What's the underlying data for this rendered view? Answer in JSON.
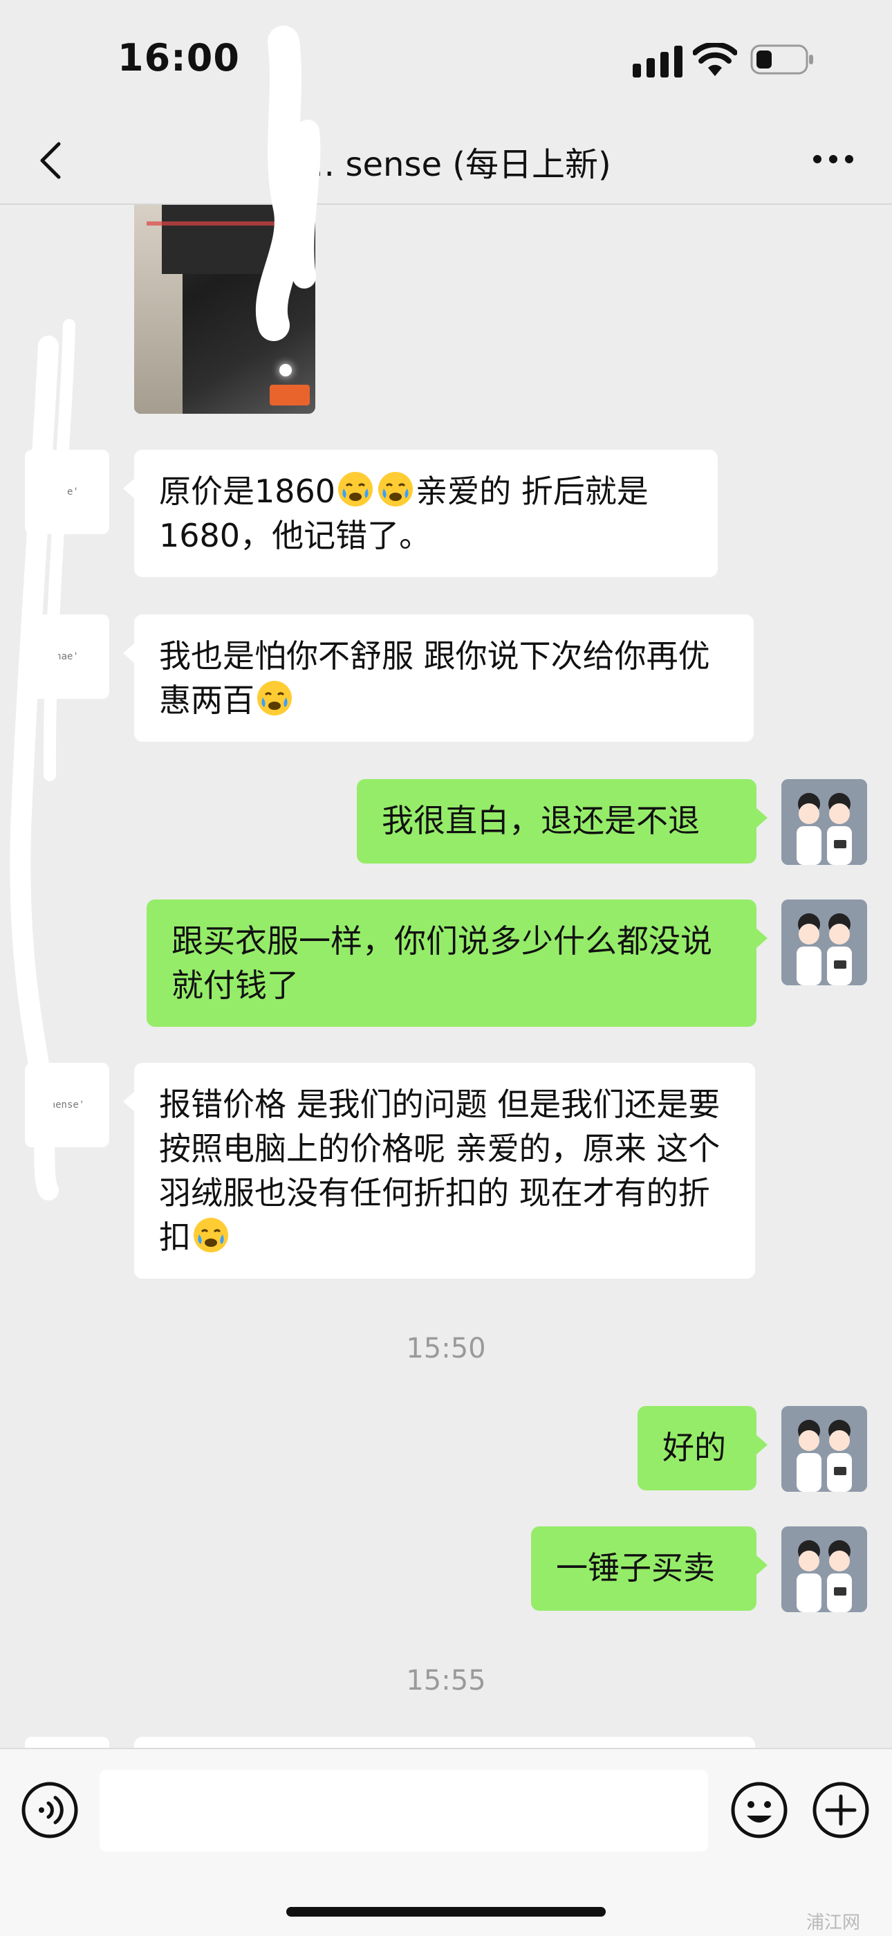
{
  "status_bar": {
    "time": "16:00"
  },
  "nav": {
    "title": "… sense (每日上新)"
  },
  "avatar_labels": {
    "seller_1": "nae'",
    "seller_2": "nae'",
    "seller_3": "aense'"
  },
  "messages": {
    "m1": {
      "part1": "原价是1860",
      "part2": "亲爱的 折后就是1680，他记错了。"
    },
    "m2": {
      "part1": "我也是怕你不舒服 跟你说下次给你再优惠两百"
    },
    "m3": {
      "text": "我很直白，退还是不退"
    },
    "m4": {
      "text": "跟买衣服一样，你们说多少什么都没说就付钱了"
    },
    "m5": {
      "part1": "报错价格 是我们的问题 但是我们还是要按照电脑上的价格呢 亲爱的，原来 这个羽绒服也没有任何折扣的 现在才有的折扣"
    },
    "m6": {
      "text": "好的"
    },
    "m7": {
      "text": "一锤子买卖"
    }
  },
  "timestamps": {
    "t1": "15:50",
    "t2": "15:55"
  },
  "input": {
    "placeholder": ""
  },
  "watermark": "浦江网",
  "colors": {
    "background": "#ededed",
    "outgoing_bubble": "#95ec69",
    "incoming_bubble": "#ffffff"
  }
}
